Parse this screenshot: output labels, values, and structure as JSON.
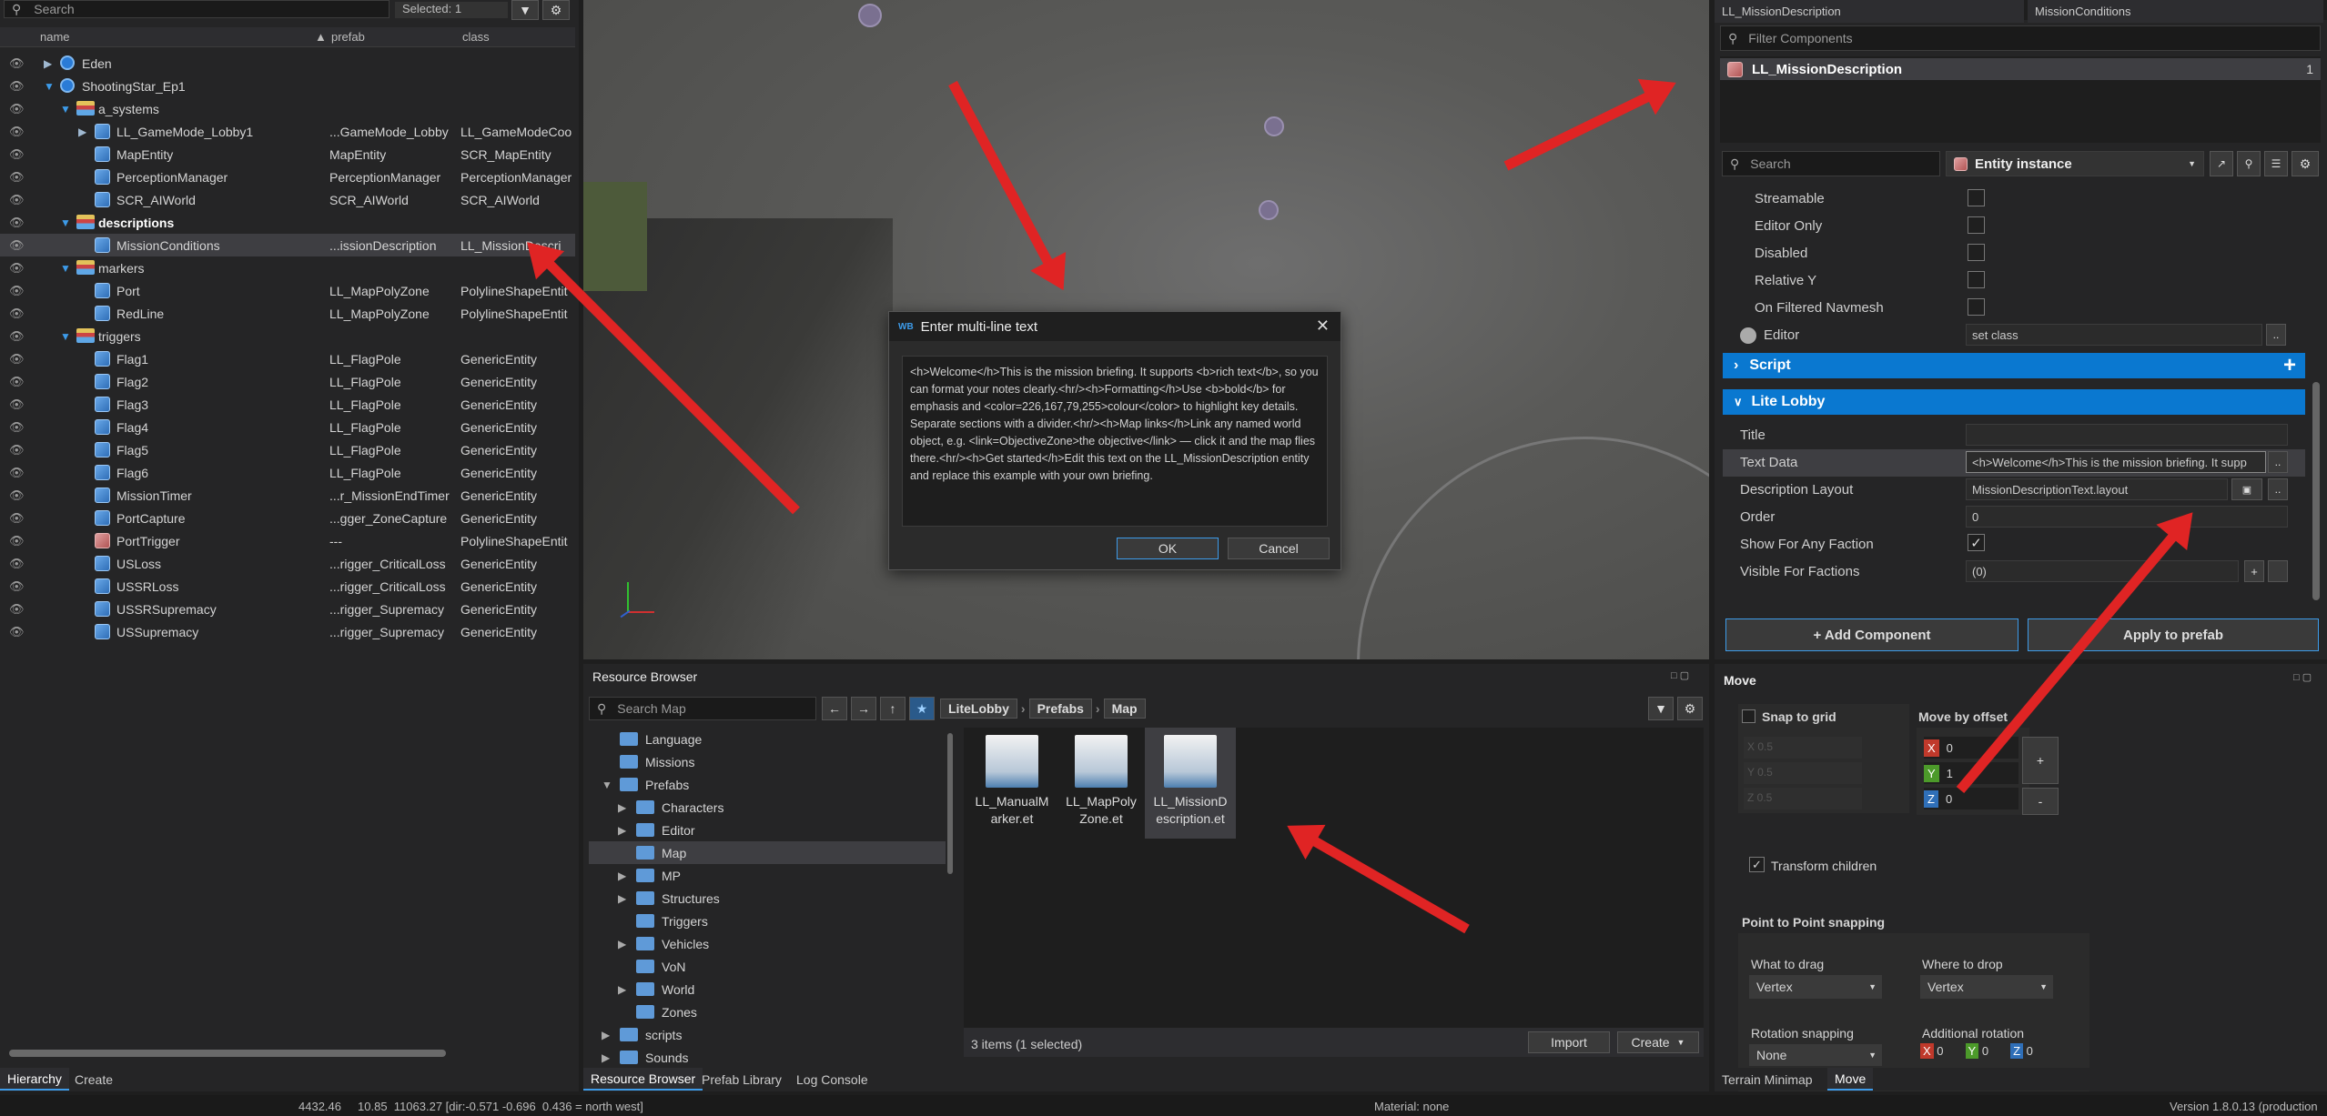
{
  "hierarchy": {
    "search_placeholder": "Search",
    "selected_label": "Selected: 1",
    "columns": [
      "name",
      "prefab",
      "class"
    ],
    "rows": [
      {
        "name": "Eden",
        "prefab": "",
        "class": "",
        "depth": 0,
        "icon": "world"
      },
      {
        "name": "ShootingStar_Ep1",
        "prefab": "",
        "class": "",
        "depth": 0,
        "icon": "world"
      },
      {
        "name": "a_systems",
        "prefab": "",
        "class": "",
        "depth": 1,
        "icon": "layer"
      },
      {
        "name": "LL_GameMode_Lobby1",
        "prefab": "...GameMode_Lobby",
        "class": "LL_GameModeCoo",
        "depth": 2,
        "icon": "cube"
      },
      {
        "name": "MapEntity",
        "prefab": "MapEntity",
        "class": "SCR_MapEntity",
        "depth": 2,
        "icon": "cube"
      },
      {
        "name": "PerceptionManager",
        "prefab": "PerceptionManager",
        "class": "PerceptionManager",
        "depth": 2,
        "icon": "cube"
      },
      {
        "name": "SCR_AIWorld",
        "prefab": "SCR_AIWorld",
        "class": "SCR_AIWorld",
        "depth": 2,
        "icon": "cube"
      },
      {
        "name": "descriptions",
        "prefab": "",
        "class": "",
        "depth": 1,
        "icon": "layer"
      },
      {
        "name": "MissionConditions",
        "prefab": "...issionDescription",
        "class": "LL_MissionDescri",
        "depth": 2,
        "icon": "cube"
      },
      {
        "name": "markers",
        "prefab": "",
        "class": "",
        "depth": 1,
        "icon": "layer"
      },
      {
        "name": "Port",
        "prefab": "LL_MapPolyZone",
        "class": "PolylineShapeEntit",
        "depth": 2,
        "icon": "cube"
      },
      {
        "name": "RedLine",
        "prefab": "LL_MapPolyZone",
        "class": "PolylineShapeEntit",
        "depth": 2,
        "icon": "cube"
      },
      {
        "name": "triggers",
        "prefab": "",
        "class": "",
        "depth": 1,
        "icon": "layer"
      },
      {
        "name": "Flag1",
        "prefab": "LL_FlagPole",
        "class": "GenericEntity",
        "depth": 2,
        "icon": "cube"
      },
      {
        "name": "Flag2",
        "prefab": "LL_FlagPole",
        "class": "GenericEntity",
        "depth": 2,
        "icon": "cube"
      },
      {
        "name": "Flag3",
        "prefab": "LL_FlagPole",
        "class": "GenericEntity",
        "depth": 2,
        "icon": "cube"
      },
      {
        "name": "Flag4",
        "prefab": "LL_FlagPole",
        "class": "GenericEntity",
        "depth": 2,
        "icon": "cube"
      },
      {
        "name": "Flag5",
        "prefab": "LL_FlagPole",
        "class": "GenericEntity",
        "depth": 2,
        "icon": "cube"
      },
      {
        "name": "Flag6",
        "prefab": "LL_FlagPole",
        "class": "GenericEntity",
        "depth": 2,
        "icon": "cube"
      },
      {
        "name": "MissionTimer",
        "prefab": "...r_MissionEndTimer",
        "class": "GenericEntity",
        "depth": 2,
        "icon": "cube"
      },
      {
        "name": "PortCapture",
        "prefab": "...gger_ZoneCapture",
        "class": "GenericEntity",
        "depth": 2,
        "icon": "cube"
      },
      {
        "name": "PortTrigger",
        "prefab": "---",
        "class": "PolylineShapeEntit",
        "depth": 2,
        "icon": "cube-red"
      },
      {
        "name": "USLoss",
        "prefab": "...rigger_CriticalLoss",
        "class": "GenericEntity",
        "depth": 2,
        "icon": "cube"
      },
      {
        "name": "USSRLoss",
        "prefab": "...rigger_CriticalLoss",
        "class": "GenericEntity",
        "depth": 2,
        "icon": "cube"
      },
      {
        "name": "USSRSupremacy",
        "prefab": "...rigger_Supremacy",
        "class": "GenericEntity",
        "depth": 2,
        "icon": "cube"
      },
      {
        "name": "USSupremacy",
        "prefab": "...rigger_Supremacy",
        "class": "GenericEntity",
        "depth": 2,
        "icon": "cube"
      }
    ],
    "bottom_tabs": [
      "Hierarchy",
      "Create"
    ]
  },
  "dialog": {
    "title": "Enter multi-line text",
    "body": "<h>Welcome</h>This is the mission briefing. It supports <b>rich text</b>, so you can format your notes clearly.<hr/><h>Formatting</h>Use <b>bold</b> for emphasis and <color=226,167,79,255>colour</color> to highlight key details. Separate sections with a divider.<hr/><h>Map links</h>Link any named world object, e.g. <link=ObjectiveZone>the objective</link> — click it and the map flies there.<hr/><h>Get started</h>Edit this text on the LL_MissionDescription entity and replace this example with your own briefing.",
    "ok_label": "OK",
    "cancel_label": "Cancel"
  },
  "resource_browser": {
    "title": "Resource Browser",
    "search_placeholder": "Search Map",
    "breadcrumb": [
      "LiteLobby",
      "Prefabs",
      "Map"
    ],
    "tree": [
      {
        "label": "Language",
        "depth": 1,
        "expand": ""
      },
      {
        "label": "Missions",
        "depth": 1,
        "expand": ""
      },
      {
        "label": "Prefabs",
        "depth": 1,
        "expand": "open"
      },
      {
        "label": "Characters",
        "depth": 2,
        "expand": "closed"
      },
      {
        "label": "Editor",
        "depth": 2,
        "expand": "closed"
      },
      {
        "label": "Map",
        "depth": 2,
        "expand": ""
      },
      {
        "label": "MP",
        "depth": 2,
        "expand": "closed"
      },
      {
        "label": "Structures",
        "depth": 2,
        "expand": "closed"
      },
      {
        "label": "Triggers",
        "depth": 2,
        "expand": ""
      },
      {
        "label": "Vehicles",
        "depth": 2,
        "expand": "closed"
      },
      {
        "label": "VoN",
        "depth": 2,
        "expand": ""
      },
      {
        "label": "World",
        "depth": 2,
        "expand": "closed"
      },
      {
        "label": "Zones",
        "depth": 2,
        "expand": ""
      },
      {
        "label": "scripts",
        "depth": 1,
        "expand": "closed"
      },
      {
        "label": "Sounds",
        "depth": 1,
        "expand": "closed"
      }
    ],
    "assets": [
      {
        "line1": "LL_ManualM",
        "line2": "arker.et"
      },
      {
        "line1": "LL_MapPoly",
        "line2": "Zone.et"
      },
      {
        "line1": "LL_MissionD",
        "line2": "escription.et"
      }
    ],
    "status": "3 items (1 selected)",
    "import_label": "Import",
    "create_label": "Create",
    "bottom_tabs": [
      "Resource Browser",
      "Prefab Library",
      "Log Console"
    ]
  },
  "inspector": {
    "tabs": [
      "LL_MissionDescription",
      "MissionConditions"
    ],
    "filter_placeholder": "Filter Components",
    "component_name": "LL_MissionDescription",
    "component_count": "1",
    "search_placeholder": "Search",
    "entity_instance_label": "Entity instance",
    "flags": [
      {
        "label": "Streamable",
        "checked": false
      },
      {
        "label": "Editor Only",
        "checked": false
      },
      {
        "label": "Disabled",
        "checked": false
      },
      {
        "label": "Relative Y",
        "checked": false
      },
      {
        "label": "On Filtered Navmesh",
        "checked": false
      }
    ],
    "editor_label": "Editor",
    "editor_value": "set class",
    "script_section": "Script",
    "lobby_section": "Lite Lobby",
    "props": {
      "title_label": "Title",
      "title_value": "",
      "text_label": "Text Data",
      "text_value": "<h>Welcome</h>This is the mission briefing. It supp",
      "layout_label": "Description Layout",
      "layout_value": "MissionDescriptionText.layout",
      "order_label": "Order",
      "order_value": "0",
      "faction_label": "Show For Any Faction",
      "faction_checked": true,
      "visible_label": "Visible For Factions",
      "visible_value": "(0)"
    },
    "add_component": "+ Add Component",
    "apply_prefab": "Apply to prefab"
  },
  "move_panel": {
    "title": "Move",
    "snap_to_grid": "Snap to grid",
    "move_by_offset": "Move by offset",
    "grid_values": [
      "0.5",
      "0.5",
      "0.5"
    ],
    "offset": {
      "x": "0",
      "y": "1",
      "z": "0"
    },
    "plus": "+",
    "minus": "-",
    "transform_children": "Transform children",
    "p2p_title": "Point to Point snapping",
    "what_to_drag": "What to drag",
    "what_to_drag_value": "Vertex",
    "where_to_drop": "Where to drop",
    "where_to_drop_value": "Vertex",
    "rotation_snapping": "Rotation snapping",
    "rotation_snapping_value": "None",
    "additional_rotation": "Additional rotation",
    "rot": {
      "x": "0",
      "y": "0",
      "z": "0"
    },
    "bottom_tabs": [
      "Terrain Minimap",
      "Move"
    ]
  },
  "status_bar": {
    "coords": "4432.46     10.85  11063.27 [dir:-0.571 -0.696  0.436 = north west]",
    "material": "Material: none",
    "version": "Version 1.8.0.13 (production"
  },
  "colors": {
    "accent": "#0a78d0",
    "arrow": "#e02424",
    "selection": "#3e3e42"
  }
}
